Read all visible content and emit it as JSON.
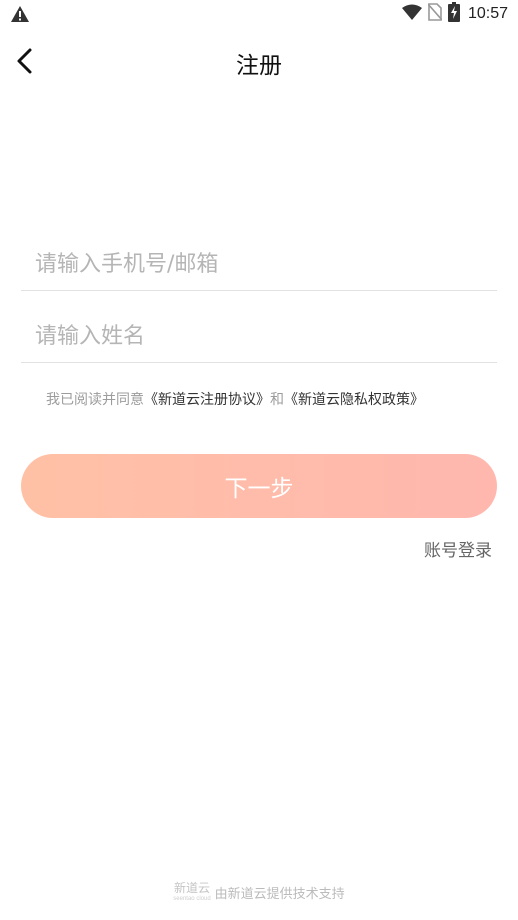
{
  "status_bar": {
    "time": "10:57",
    "icons": [
      "warning-icon",
      "wifi-icon",
      "no-sim-icon",
      "battery-charging-icon"
    ]
  },
  "nav": {
    "title": "注册",
    "back_icon": "chevron-left-icon"
  },
  "form": {
    "phone_placeholder": "请输入手机号/邮箱",
    "phone_value": "",
    "name_placeholder": "请输入姓名",
    "name_value": ""
  },
  "agreement": {
    "prefix": "我已阅读并同意",
    "terms_link": "《新道云注册协议》",
    "conjunction": "和",
    "privacy_link": "《新道云隐私权政策》"
  },
  "actions": {
    "next_label": "下一步",
    "account_login_label": "账号登录"
  },
  "footer": {
    "logo_text": "新道云",
    "logo_subtext": "seentao cloud",
    "support_text": "由新道云提供技术支持"
  },
  "colors": {
    "button_gradient_start": "#ffc1a6",
    "button_gradient_end": "#ffb7ae",
    "placeholder": "#b5b5b5",
    "divider": "#e2e2e2"
  }
}
